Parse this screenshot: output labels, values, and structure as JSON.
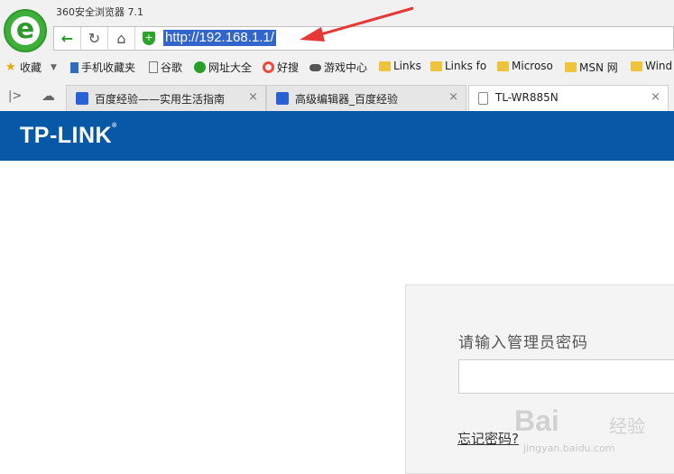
{
  "browser": {
    "title": "360安全浏览器 7.1",
    "url": "http://192.168.1.1/",
    "accent_color": "#3dae3a"
  },
  "bookmarks": [
    {
      "label": "收藏",
      "icon": "star-icon"
    },
    {
      "label": "手机收藏夹",
      "icon": "phone-icon"
    },
    {
      "label": "谷歌",
      "icon": "page-icon"
    },
    {
      "label": "网址大全",
      "icon": "site-nav-icon"
    },
    {
      "label": "好搜",
      "icon": "search-icon"
    },
    {
      "label": "游戏中心",
      "icon": "gamepad-icon"
    },
    {
      "label": "Links",
      "icon": "folder-icon"
    },
    {
      "label": "Links fo",
      "icon": "folder-icon"
    },
    {
      "label": "Microso",
      "icon": "folder-icon"
    },
    {
      "label": "MSN 网",
      "icon": "folder-icon"
    },
    {
      "label": "Wind",
      "icon": "folder-icon"
    }
  ],
  "tabs": [
    {
      "label": "百度经验——实用生活指南",
      "active": false
    },
    {
      "label": "高级编辑器_百度经验",
      "active": false
    },
    {
      "label": "TL-WR885N",
      "active": true
    }
  ],
  "page": {
    "brand": "TP-LINK",
    "banner_color": "#0758a6",
    "login": {
      "prompt": "请输入管理员密码",
      "forgot": "忘记密码?"
    }
  },
  "watermark": {
    "brand": "Bai",
    "suffix": "经验",
    "site": "jingyan.baidu.com"
  }
}
